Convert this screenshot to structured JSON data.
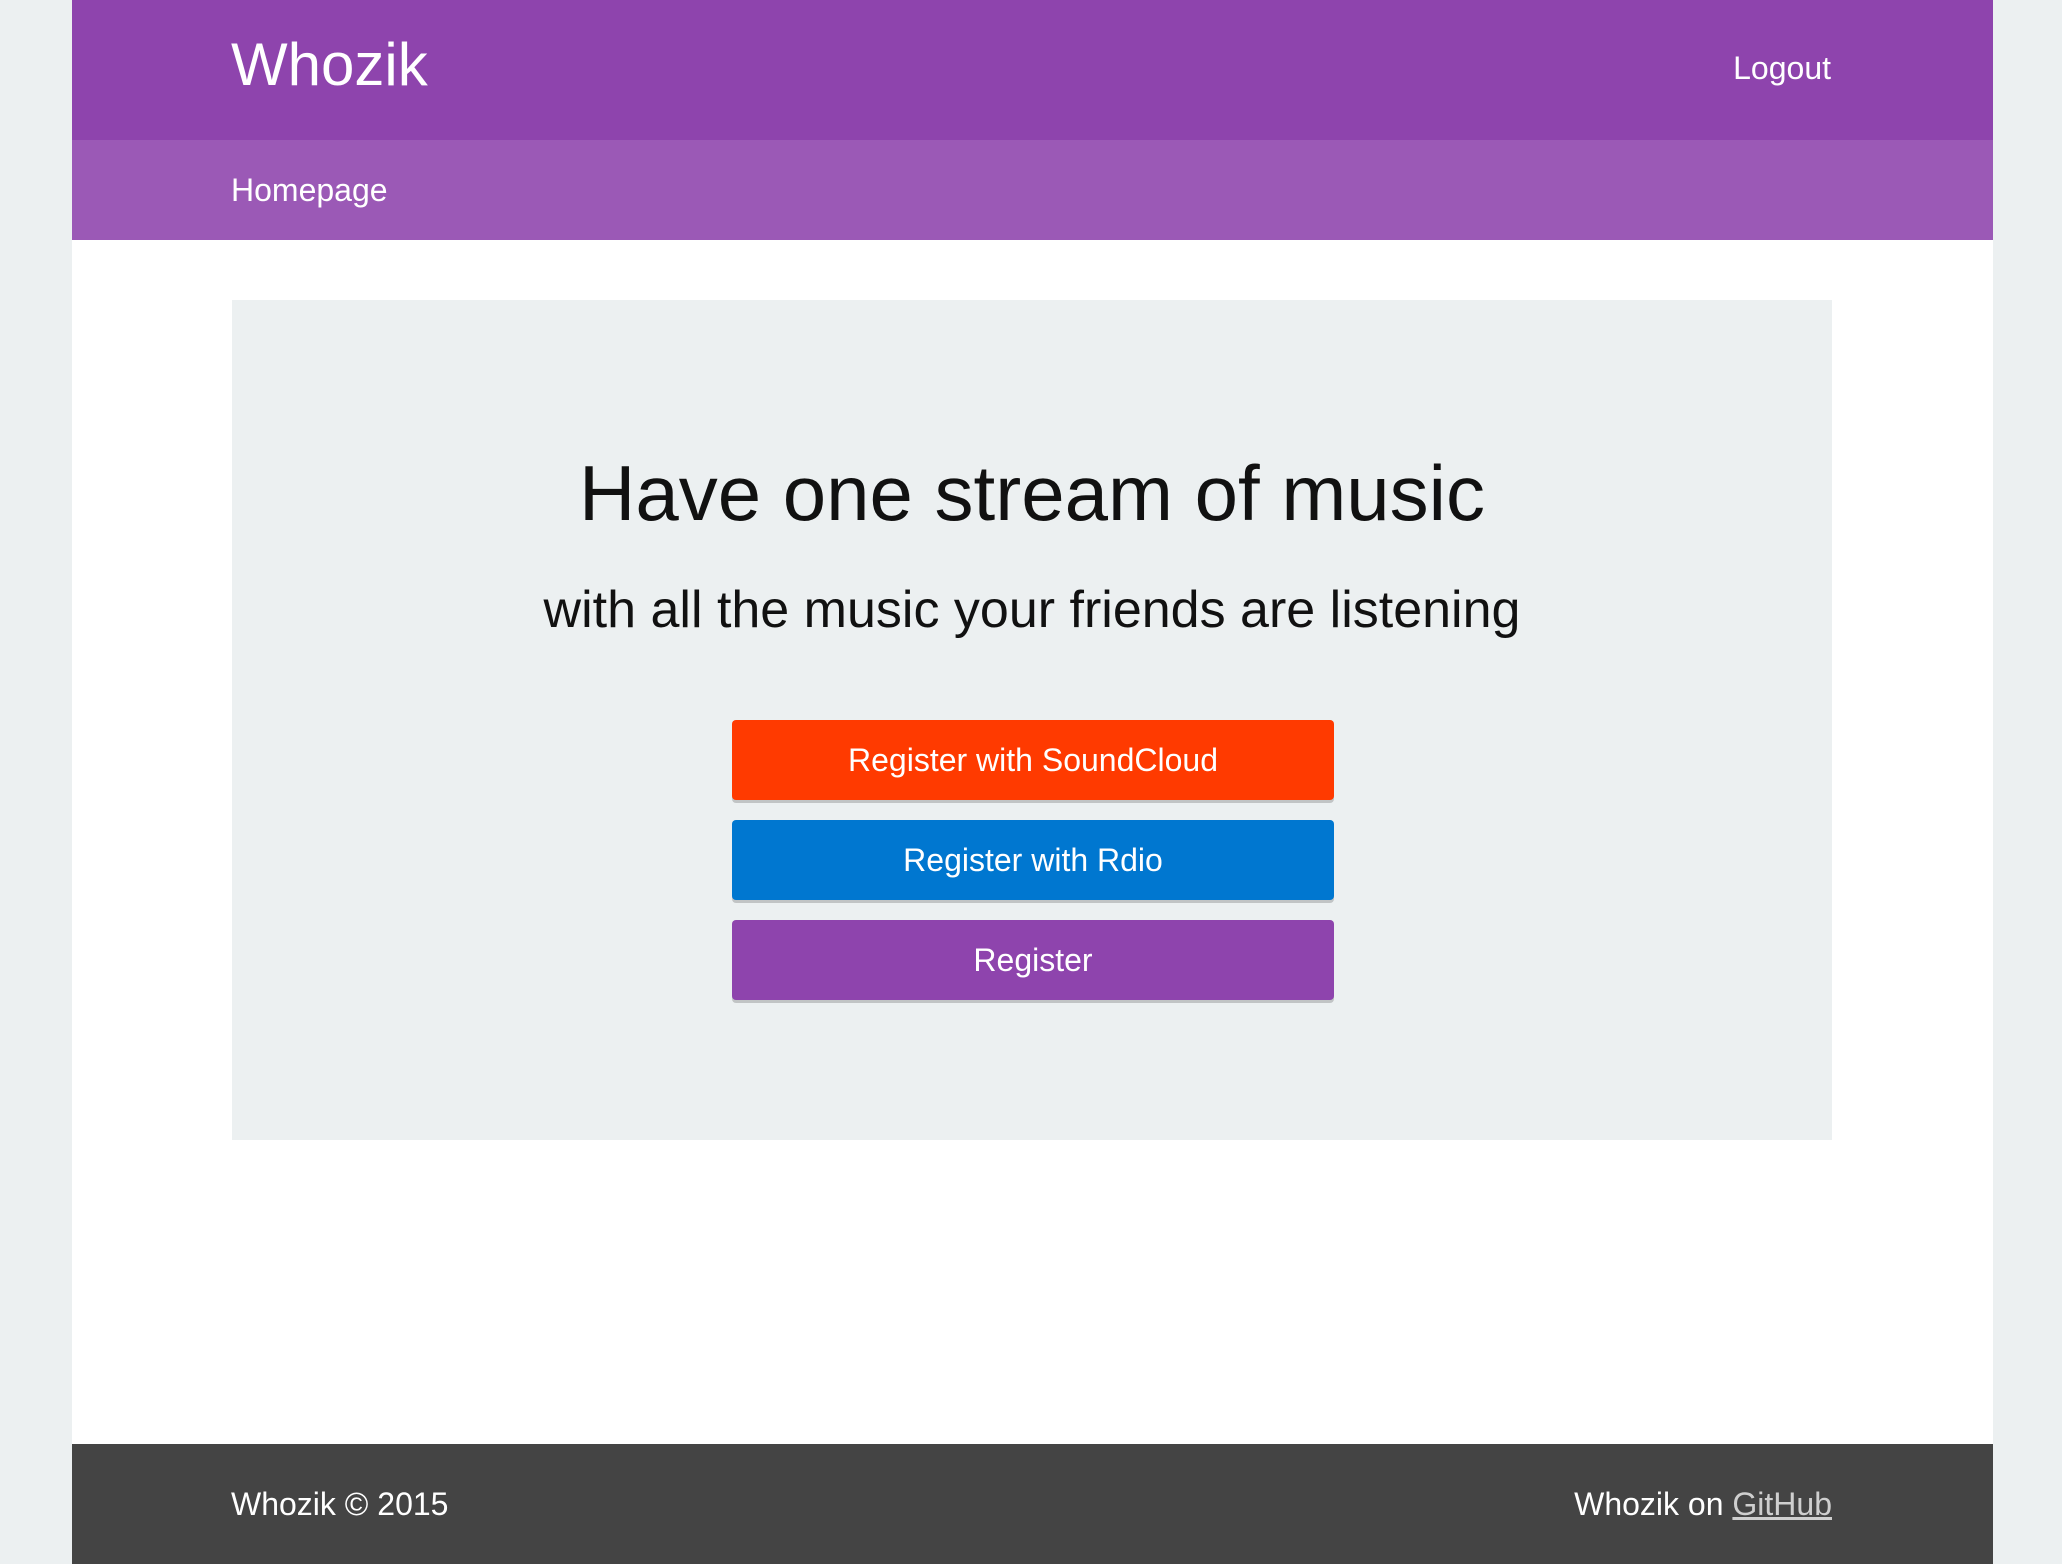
{
  "colors": {
    "background": "#ecf0f1",
    "primary": "#8e44ad",
    "primary_light": "#9b59b6",
    "soundcloud": "#ff3a00",
    "rdio": "#0077d0",
    "footer": "#444444",
    "hero_bg": "#ecf0f1"
  },
  "header": {
    "brand": "Whozik",
    "logout_label": "Logout"
  },
  "subnav": {
    "items": [
      {
        "label": "Homepage"
      }
    ]
  },
  "hero": {
    "title": "Have one stream of music",
    "subtitle": "with all the music your friends are listening",
    "buttons": {
      "soundcloud_label": "Register with SoundCloud",
      "rdio_label": "Register with Rdio",
      "register_label": "Register"
    }
  },
  "footer": {
    "copyright": "Whozik © 2015",
    "repo_prefix": "Whozik on",
    "repo_link_label": "GitHub"
  }
}
